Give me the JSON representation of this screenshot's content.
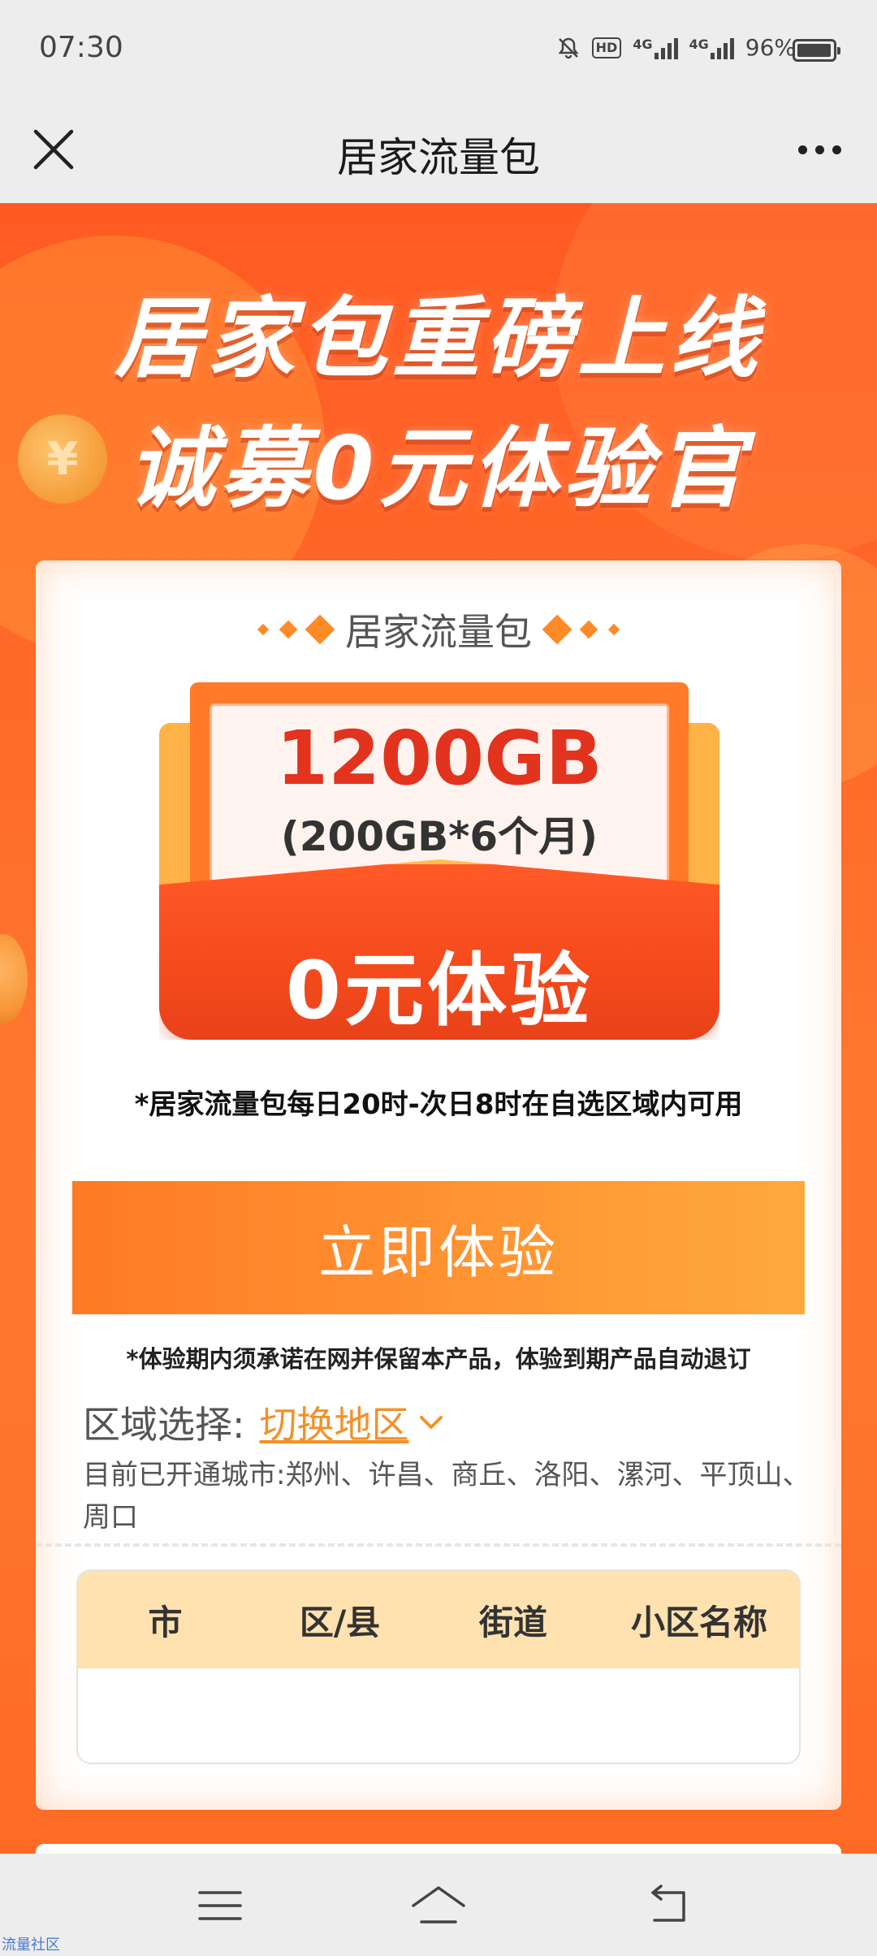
{
  "status_bar": {
    "time": "07:30",
    "hd_label": "HD",
    "net1_label": "4G",
    "net2_label": "4G",
    "battery": "96%",
    "icons": [
      "mute-bell-icon",
      "hd-icon",
      "signal-icon",
      "signal-icon",
      "battery-icon"
    ]
  },
  "titlebar": {
    "title": "居家流量包",
    "close_icon": "close-icon",
    "more_icon": "more-icon"
  },
  "banner": {
    "headline_line1": "居家包重磅上线",
    "headline_line2": "诚募0元体验官",
    "coin_glyph": "¥"
  },
  "card": {
    "title": "居家流量包",
    "package_amount": "1200GB",
    "package_detail": "(200GB*6个月)",
    "package_price": "0元体验",
    "usage_note": "*居家流量包每日20时-次日8时在自选区域内可用",
    "cta_label": "立即体验",
    "commitment_note": "*体验期内须承诺在网并保留本产品，体验到期产品自动退订",
    "region_label": "区域选择:",
    "region_switch": "切换地区",
    "cities_text": "目前已开通城市:郑州、许昌、商丘、洛阳、漯河、平顶山、周口",
    "table_headers": [
      "市",
      "区/县",
      "街道",
      "小区名称"
    ]
  },
  "nav": {
    "icons": [
      "menu-icon",
      "home-icon",
      "back-icon"
    ]
  },
  "watermark": "流量社区",
  "colors": {
    "accent_orange": "#ff7a26",
    "banner_red": "#ff5a22",
    "price_red": "#e2331e",
    "link_orange": "#f2912a",
    "table_header_bg": "#ffe2b0"
  }
}
